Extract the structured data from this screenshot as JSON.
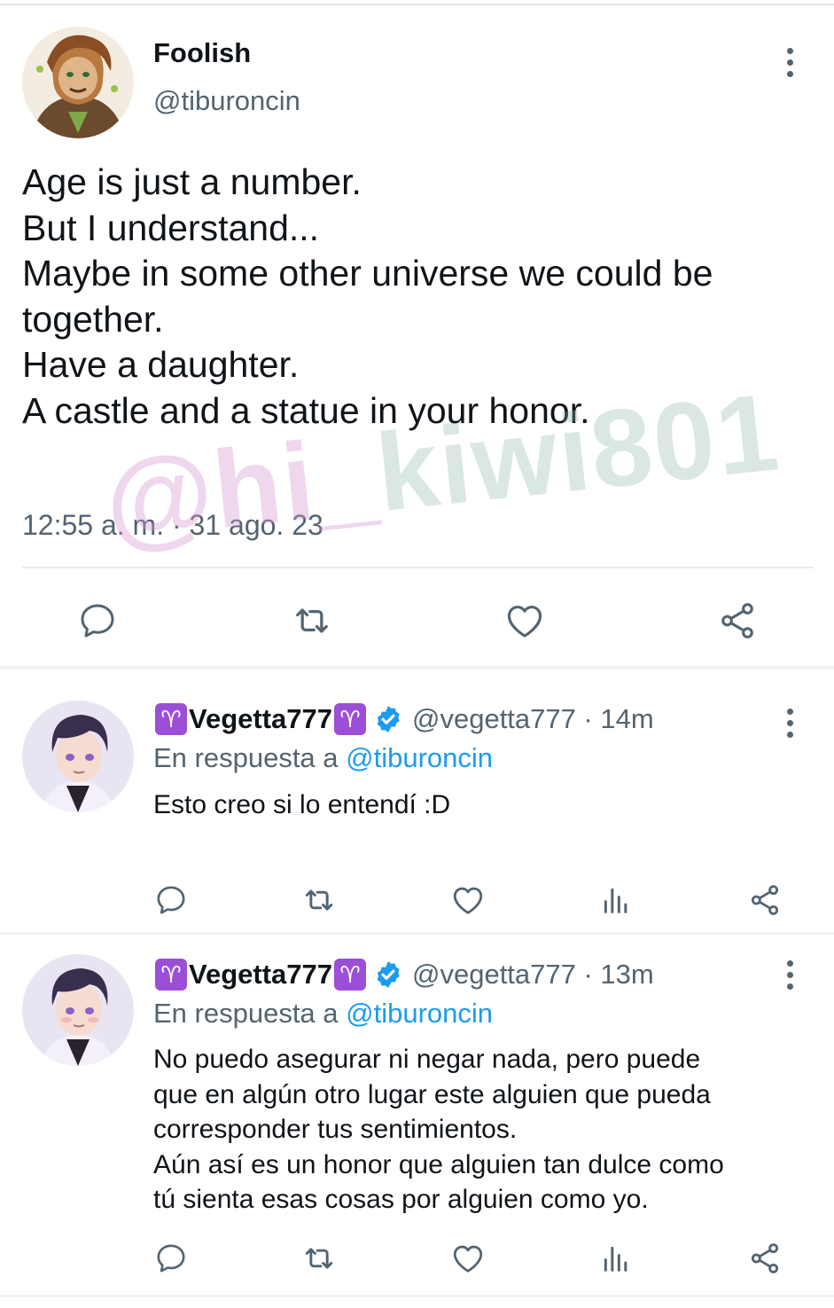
{
  "main_tweet": {
    "display_name": "Foolish",
    "handle": "@tiburoncin",
    "text_lines": [
      "Age is just a number.",
      "But I understand...",
      "Maybe in some other universe we could be",
      "together.",
      "Have a daughter.",
      "A castle and a statue in your honor."
    ],
    "timestamp": "12:55 a. m. · 31 ago. 23",
    "actions": [
      "reply-icon",
      "retweet-icon",
      "like-icon",
      "share-icon"
    ]
  },
  "watermark": {
    "part1": "@hi_",
    "part2": "kiwi801"
  },
  "replies": [
    {
      "zodiac_symbol": "♈",
      "display_name": "Vegetta777",
      "handle_time": "@vegetta777 · 14m",
      "replying_prefix": "En respuesta a ",
      "replying_mention": "@tiburoncin",
      "text_lines": [
        "Esto creo si lo entendí :D"
      ],
      "actions": [
        "reply-icon",
        "retweet-icon",
        "like-icon",
        "views-icon",
        "share-icon"
      ]
    },
    {
      "zodiac_symbol": "♈",
      "display_name": "Vegetta777",
      "handle_time": "@vegetta777 · 13m",
      "replying_prefix": "En respuesta a ",
      "replying_mention": "@tiburoncin",
      "text_lines": [
        "No puedo asegurar ni negar nada, pero puede",
        "que en algún otro lugar este alguien que pueda",
        "corresponder tus sentimientos.",
        "Aún así es un honor que alguien tan dulce como",
        "tú sienta esas cosas por alguien como yo."
      ],
      "actions": [
        "reply-icon",
        "retweet-icon",
        "like-icon",
        "views-icon",
        "share-icon"
      ]
    }
  ],
  "colors": {
    "text": "#0f1419",
    "secondary": "#536471",
    "link": "#1d9bf0",
    "verified": "#1d9bf0",
    "zodiac": "#9b4fd6"
  }
}
